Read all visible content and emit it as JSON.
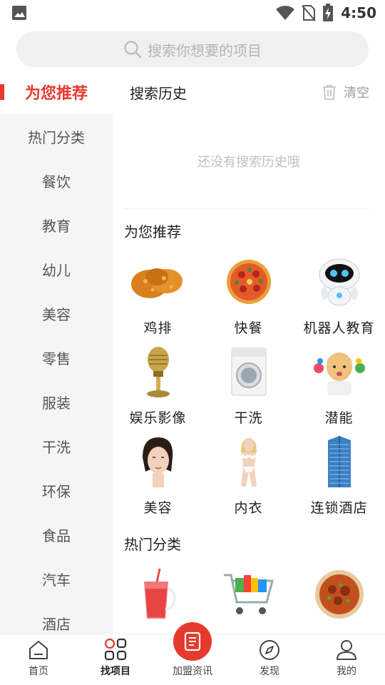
{
  "status_bar": {
    "time": "4:50"
  },
  "search": {
    "placeholder": "搜索你想要的项目"
  },
  "sidebar": {
    "items": [
      {
        "label": "为您推荐",
        "active": true
      },
      {
        "label": "热门分类"
      },
      {
        "label": "餐饮"
      },
      {
        "label": "教育"
      },
      {
        "label": "幼儿"
      },
      {
        "label": "美容"
      },
      {
        "label": "零售"
      },
      {
        "label": "服装"
      },
      {
        "label": "干洗"
      },
      {
        "label": "环保"
      },
      {
        "label": "食品"
      },
      {
        "label": "汽车"
      },
      {
        "label": "酒店"
      }
    ]
  },
  "history": {
    "title": "搜索历史",
    "clear_label": "清空",
    "empty_text": "还没有搜索历史哦"
  },
  "recommend": {
    "title": "为您推荐",
    "items": [
      {
        "label": "鸡排",
        "icon": "fried-chicken"
      },
      {
        "label": "快餐",
        "icon": "pizza"
      },
      {
        "label": "机器人教育",
        "icon": "robot"
      },
      {
        "label": "娱乐影像",
        "icon": "microphone"
      },
      {
        "label": "干洗",
        "icon": "washing-machine"
      },
      {
        "label": "潜能",
        "icon": "child"
      },
      {
        "label": "美容",
        "icon": "woman-face"
      },
      {
        "label": "内衣",
        "icon": "lingerie-model"
      },
      {
        "label": "连锁酒店",
        "icon": "hotel-building"
      }
    ]
  },
  "hot": {
    "title": "热门分类",
    "items": [
      {
        "icon": "drink"
      },
      {
        "icon": "shopping-cart"
      },
      {
        "icon": "food-bowl"
      }
    ]
  },
  "bottom_nav": {
    "items": [
      {
        "label": "首页"
      },
      {
        "label": "找项目",
        "active": true
      },
      {
        "label": "加盟资讯"
      },
      {
        "label": "发现"
      },
      {
        "label": "我的"
      }
    ]
  },
  "colors": {
    "accent": "#e63a2e",
    "sidebar_bg": "#f5f5f5"
  }
}
